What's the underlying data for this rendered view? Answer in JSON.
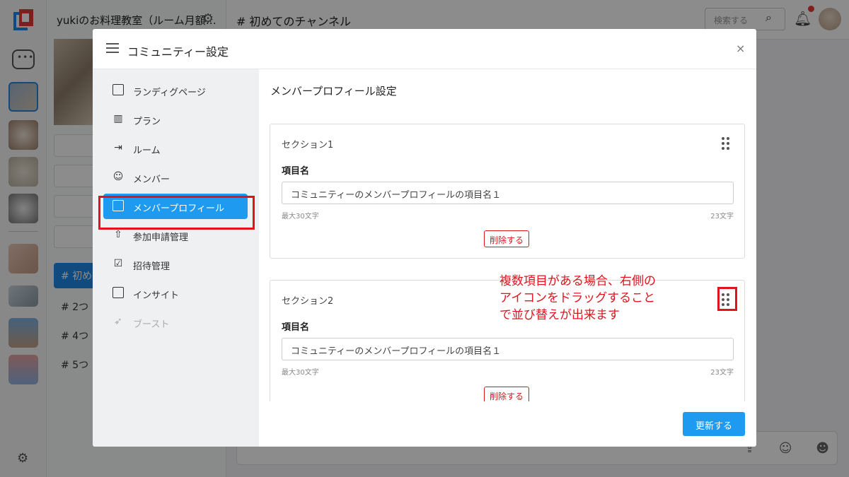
{
  "app": {
    "community_title": "yukiのお料理教室（ルーム月額…",
    "channel_title": "初めてのチャンネル",
    "search_placeholder": "検索する",
    "active_channel": "初め",
    "channels": [
      "2つ",
      "4つ",
      "5つ"
    ]
  },
  "modal": {
    "title": "コミュニティー設定",
    "close": "×",
    "nav": [
      {
        "label": "ランディグページ",
        "icon": "landing-page-icon"
      },
      {
        "label": "プラン",
        "icon": "bar-chart-icon"
      },
      {
        "label": "ルーム",
        "icon": "room-icon"
      },
      {
        "label": "メンバー",
        "icon": "smiley-icon"
      },
      {
        "label": "メンバープロフィール",
        "icon": "profile-icon",
        "active": true
      },
      {
        "label": "参加申請管理",
        "icon": "application-icon"
      },
      {
        "label": "招待管理",
        "icon": "clipboard-icon"
      },
      {
        "label": "インサイト",
        "icon": "insight-icon"
      },
      {
        "label": "ブースト",
        "icon": "rocket-icon",
        "disabled": true
      }
    ],
    "content_title": "メンバープロフィール設定",
    "sections": [
      {
        "name": "セクション1",
        "field_label": "項目名",
        "value": "コミュニティーのメンバープロフィールの項目名１",
        "hint": "最大30文字",
        "count": "23文字",
        "delete_label": "削除する"
      },
      {
        "name": "セクション2",
        "field_label": "項目名",
        "value": "コミュニティーのメンバープロフィールの項目名１",
        "hint": "最大30文字",
        "count": "23文字",
        "delete_label": "削除する"
      }
    ],
    "update_label": "更新する"
  },
  "annotation": {
    "lines": [
      "複数項目がある場合、右側の",
      "アイコンをドラッグすること",
      "で並び替えが出来ます"
    ],
    "color": "#e0141e"
  },
  "colors": {
    "accent": "#1e9bf0",
    "highlight": "#e0141e"
  }
}
